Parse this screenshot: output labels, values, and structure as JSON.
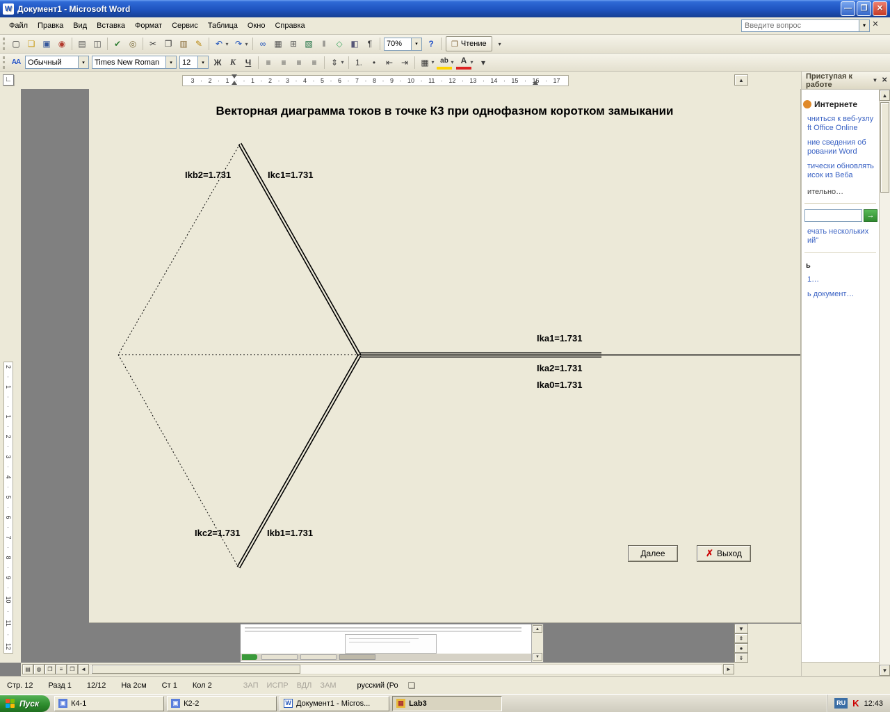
{
  "window": {
    "icon_glyph": "W",
    "title": "Документ1 - Microsoft Word",
    "minimize_glyph": "—",
    "restore_glyph": "❐",
    "close_glyph": "✕"
  },
  "menu": {
    "items": [
      {
        "name": "menu-file",
        "label": "Файл"
      },
      {
        "name": "menu-edit",
        "label": "Правка"
      },
      {
        "name": "menu-view",
        "label": "Вид"
      },
      {
        "name": "menu-insert",
        "label": "Вставка"
      },
      {
        "name": "menu-format",
        "label": "Формат"
      },
      {
        "name": "menu-tools",
        "label": "Сервис"
      },
      {
        "name": "menu-table",
        "label": "Таблица"
      },
      {
        "name": "menu-window",
        "label": "Окно"
      },
      {
        "name": "menu-help",
        "label": "Справка"
      }
    ],
    "question_placeholder": "Введите вопрос",
    "dropdown_glyph": "▾",
    "close_glyph": "✕"
  },
  "toolbar_std": {
    "icons": [
      {
        "name": "new-document-icon",
        "glyph": "▢"
      },
      {
        "name": "open-icon",
        "glyph": "❏",
        "color": "#c79810"
      },
      {
        "name": "save-icon",
        "glyph": "▣",
        "color": "#35579b"
      },
      {
        "name": "permission-icon",
        "glyph": "◉",
        "color": "#b23b2e"
      },
      {
        "name": "separator",
        "glyph": "",
        "cls": "sep"
      },
      {
        "name": "print-icon",
        "glyph": "▤",
        "color": "#555555"
      },
      {
        "name": "print-preview-icon",
        "glyph": "◫",
        "color": "#555555"
      },
      {
        "name": "separator",
        "glyph": "",
        "cls": "sep"
      },
      {
        "name": "spelling-icon",
        "glyph": "✔",
        "color": "#2e7d32"
      },
      {
        "name": "research-icon",
        "glyph": "◎",
        "color": "#7a6a3a"
      },
      {
        "name": "separator",
        "glyph": "",
        "cls": "sep"
      },
      {
        "name": "cut-icon",
        "glyph": "✂"
      },
      {
        "name": "copy-icon",
        "glyph": "❐"
      },
      {
        "name": "paste-icon",
        "glyph": "▥",
        "color": "#8a6d3b"
      },
      {
        "name": "format-painter-icon",
        "glyph": "✎",
        "color": "#b8860b"
      },
      {
        "name": "separator",
        "glyph": "",
        "cls": "sep"
      },
      {
        "name": "undo-icon",
        "glyph": "↶",
        "color": "#1a4fba"
      },
      {
        "name": "undo-dropdown-icon",
        "glyph": "▾",
        "cls": "dd"
      },
      {
        "name": "redo-icon",
        "glyph": "↷",
        "color": "#1a4fba"
      },
      {
        "name": "redo-dropdown-icon",
        "glyph": "▾",
        "cls": "dd"
      },
      {
        "name": "separator",
        "glyph": "",
        "cls": "sep"
      },
      {
        "name": "hyperlink-icon",
        "glyph": "∞",
        "color": "#1a4fba"
      },
      {
        "name": "tables-and-borders-icon",
        "glyph": "▦",
        "color": "#555555"
      },
      {
        "name": "insert-table-icon",
        "glyph": "⊞",
        "color": "#555555"
      },
      {
        "name": "insert-excel-icon",
        "glyph": "▧",
        "color": "#1d6f42"
      },
      {
        "name": "columns-icon",
        "glyph": "‖",
        "color": "#555555"
      },
      {
        "name": "drawing-icon",
        "glyph": "◇",
        "color": "#44aa66"
      },
      {
        "name": "document-map-icon",
        "glyph": "◧",
        "color": "#555577"
      },
      {
        "name": "show-paragraph-icon",
        "glyph": "¶"
      },
      {
        "name": "separator",
        "glyph": "",
        "cls": "sep"
      }
    ],
    "zoom_value": "70%",
    "zoom_dropdown_glyph": "▾",
    "icons_after": [
      {
        "name": "help-icon",
        "glyph": "?",
        "color": "#2050c8",
        "cls": "b"
      },
      {
        "name": "separator",
        "glyph": "",
        "cls": "sep"
      }
    ],
    "reading_icon_glyph": "❒",
    "reading_label": "Чтение",
    "overflow_glyph": "▾"
  },
  "toolbar_fmt": {
    "styles_icon_text": "АА",
    "style_value": "Обычный",
    "font_value": "Times New Roman",
    "size_value": "12",
    "combo_dropdown_glyph": "▾",
    "icons": [
      {
        "name": "bold-icon",
        "glyph": "Ж",
        "cls": "b"
      },
      {
        "name": "italic-icon",
        "glyph": "К",
        "cls": "i"
      },
      {
        "name": "underline-icon",
        "glyph": "Ч",
        "cls": "u"
      },
      {
        "name": "separator",
        "glyph": "",
        "cls": "sep"
      },
      {
        "name": "align-left-icon",
        "glyph": "≡"
      },
      {
        "name": "align-center-icon",
        "glyph": "≡"
      },
      {
        "name": "align-right-icon",
        "glyph": "≡"
      },
      {
        "name": "justify-icon",
        "glyph": "≡"
      },
      {
        "name": "separator",
        "glyph": "",
        "cls": "sep"
      },
      {
        "name": "line-spacing-icon",
        "glyph": "⇕"
      },
      {
        "name": "line-spacing-dropdown-icon",
        "glyph": "▾",
        "cls": "dd"
      },
      {
        "name": "separator",
        "glyph": "",
        "cls": "sep"
      },
      {
        "name": "numbering-icon",
        "glyph": "1."
      },
      {
        "name": "bullets-icon",
        "glyph": "•"
      },
      {
        "name": "decrease-indent-icon",
        "glyph": "⇤"
      },
      {
        "name": "increase-indent-icon",
        "glyph": "⇥"
      },
      {
        "name": "separator",
        "glyph": "",
        "cls": "sep"
      },
      {
        "name": "borders-icon",
        "glyph": "▦"
      },
      {
        "name": "borders-dropdown-icon",
        "glyph": "▾",
        "cls": "dd"
      },
      {
        "name": "highlight-icon",
        "glyph": "ab",
        "cls": "hl"
      },
      {
        "name": "highlight-dropdown-icon",
        "glyph": "▾",
        "cls": "dd"
      },
      {
        "name": "font-color-icon",
        "glyph": "А",
        "cls": "fc"
      },
      {
        "name": "font-color-dropdown-icon",
        "glyph": "▾",
        "cls": "dd"
      },
      {
        "name": "toolbar-options-icon",
        "glyph": "▾"
      }
    ]
  },
  "ruler": {
    "tab_glyph": "∟",
    "h_numbers": "3 · 2 · 1 · · 1 · 2 · 3 · 4 · 5 · 6 · 7 · 8 · 9 · 10 · 11 · 12 · 13 · 14 · 15 · 16 · 17",
    "v_numbers": "2 · 1 · · 1 · 2 · 3 · 4 · 5 · 6 · 7 · 8 · 9 · 10 · 11 · 12"
  },
  "document": {
    "title": "Векторная диаграмма токов в точке К3 при однофазном коротком замыкании",
    "labels": {
      "ikb2": "Ikb2=1.731",
      "ikc1": "Ikc1=1.731",
      "ika1": "Ika1=1.731",
      "ika2": "Ika2=1.731",
      "ika0": "Ika0=1.731",
      "ikc2": "Ikc2=1.731",
      "ikb1": "Ikb1=1.731"
    },
    "next_button": "Далее",
    "exit_button": "Выход",
    "exit_icon_glyph": "✗"
  },
  "task_pane": {
    "title": "Приступая к работе",
    "dropdown_glyph": "▼",
    "close_glyph": "✕",
    "section_title": "Интернете",
    "links": [
      {
        "name": "task-pane-link-office-online",
        "label": "чниться к веб-узлу ft Office Online"
      },
      {
        "name": "task-pane-link-word-info",
        "label": "ние сведения об ровании Word"
      },
      {
        "name": "task-pane-link-update-list",
        "label": "тически обновлять исок из Веба"
      }
    ],
    "more_label": "ительно…",
    "search_button_glyph": "→",
    "help_link": "ечать нескольких ий\"",
    "open_section_title": "ь",
    "open_links": [
      {
        "name": "task-pane-recent-file-link",
        "label": "1…"
      },
      {
        "name": "task-pane-create-document-link",
        "label": "ь документ…"
      }
    ]
  },
  "scrollbars": {
    "up_glyph": "▲",
    "down_glyph": "▼",
    "left_glyph": "◄",
    "right_glyph": "►",
    "scroll_down_glyph": "▼",
    "prev_page_glyph": "⇞",
    "browse_glyph": "●",
    "next_page_glyph": "⇟"
  },
  "view_buttons": [
    {
      "name": "view-normal-icon",
      "glyph": "▤"
    },
    {
      "name": "view-web-icon",
      "glyph": "◍"
    },
    {
      "name": "view-print-layout-icon",
      "glyph": "❐"
    },
    {
      "name": "view-outline-icon",
      "glyph": "≡"
    },
    {
      "name": "view-reading-icon",
      "glyph": "❒"
    }
  ],
  "status_bar": {
    "items": [
      "Стр. 12",
      "Разд 1",
      "12/12",
      "На 2см",
      "Ст 1",
      "Кол 2"
    ],
    "toggles": [
      "ЗАП",
      "ИСПР",
      "ВДЛ",
      "ЗАМ"
    ],
    "language": "русский (Ро",
    "book_icon_glyph": "❏"
  },
  "taskbar": {
    "start_label": "Пуск",
    "tasks": [
      {
        "name": "taskbar-task-k4-1",
        "label": "К4-1",
        "icon_glyph": "▣",
        "cls": "t-app"
      },
      {
        "name": "taskbar-task-k2-2",
        "label": "К2-2",
        "icon_glyph": "▣",
        "cls": "t-app"
      },
      {
        "name": "taskbar-task-document1",
        "label": "Документ1 - Micros...",
        "icon_glyph": "W",
        "cls": "t-word"
      },
      {
        "name": "taskbar-task-lab3",
        "label": "Lab3",
        "icon_glyph": "▦",
        "cls": "t-lab active"
      }
    ],
    "tray_lang": "RU",
    "tray_av_glyph": "K",
    "clock": "12:43"
  }
}
